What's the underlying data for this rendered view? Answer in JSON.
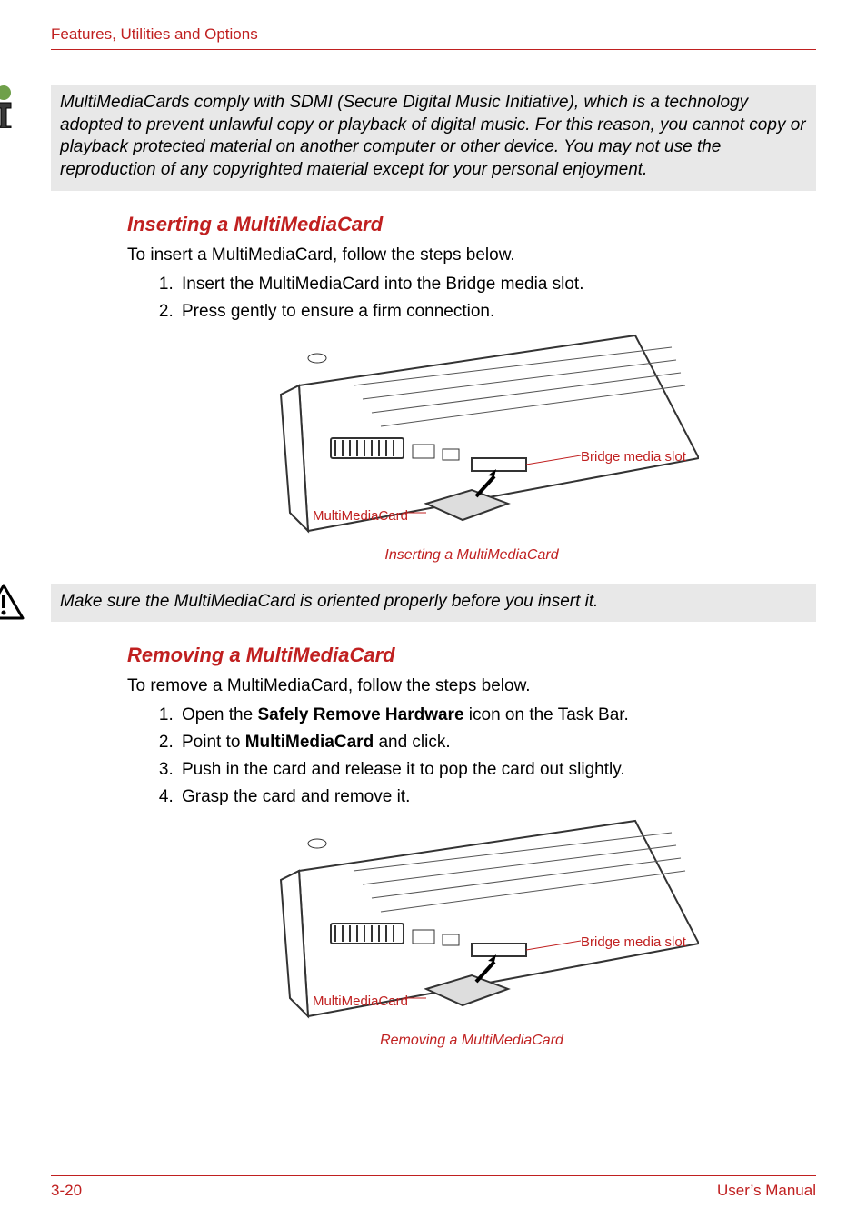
{
  "header": "Features, Utilities and Options",
  "info_box": "MultiMediaCards comply with SDMI (Secure Digital Music Initiative), which is a technology adopted to prevent unlawful copy or playback of digital music. For this reason, you cannot copy or playback protected material on another computer or other device. You may not use the reproduction of any copyrighted material except for your personal enjoyment.",
  "section1": {
    "title": "Inserting a MultiMediaCard",
    "intro": "To insert a MultiMediaCard, follow the steps below.",
    "steps": [
      "Insert the MultiMediaCard into the Bridge media slot.",
      "Press gently to ensure a firm connection."
    ],
    "fig_label_right": "Bridge media slot",
    "fig_label_left": "MultiMediaCard",
    "caption": "Inserting a MultiMediaCard"
  },
  "warning_box": "Make sure the MultiMediaCard is oriented properly before you insert it.",
  "section2": {
    "title": "Removing a MultiMediaCard",
    "intro": "To remove a MultiMediaCard, follow the steps below.",
    "steps": [
      {
        "pre": "Open the ",
        "bold": "Safely Remove Hardware",
        "post": " icon on the Task Bar."
      },
      {
        "pre": "Point to ",
        "bold": "MultiMediaCard",
        "post": " and click."
      },
      {
        "plain": "Push in the card and release it to pop the card out slightly."
      },
      {
        "plain": "Grasp the card and remove it."
      }
    ],
    "fig_label_right": "Bridge media slot",
    "fig_label_left": "MultiMediaCard",
    "caption": "Removing a MultiMediaCard"
  },
  "footer": {
    "page": "3-20",
    "manual": "User’s Manual"
  }
}
